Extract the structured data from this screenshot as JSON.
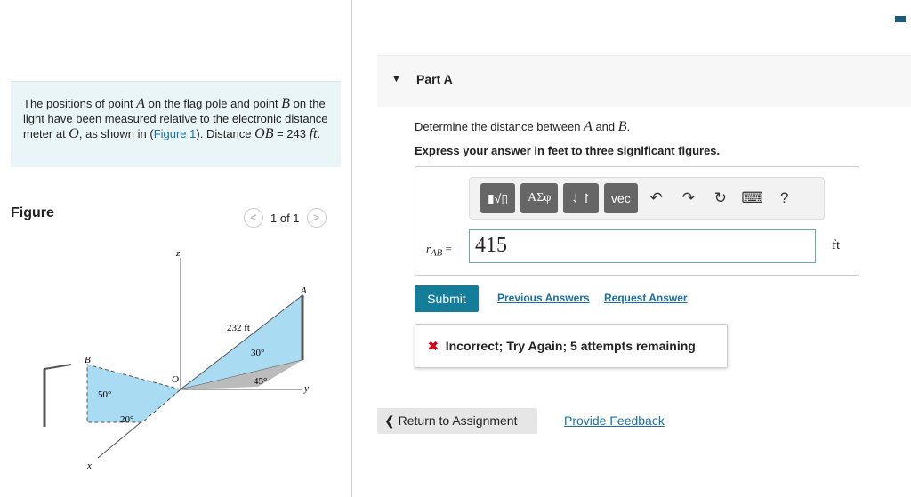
{
  "problem": {
    "t1": "The positions of point ",
    "A": "A",
    "t2": " on the flag pole and point ",
    "B": "B",
    "t3": " on the light have been measured relative to the electronic distance meter at ",
    "O": "O",
    "t4": ", as shown in (",
    "link": "Figure 1",
    "t5": "). Distance ",
    "OB": "OB",
    "t6": " = 243 ",
    "ft": "ft",
    "t7": "."
  },
  "figure": {
    "title": "Figure",
    "pager": "1 of 1",
    "labels": {
      "z": "z",
      "A": "A",
      "B": "B",
      "O": "O",
      "x": "x",
      "y": "y",
      "d232": "232 ft",
      "a30": "30°",
      "a45": "45°",
      "a50": "50°",
      "a20": "20°"
    }
  },
  "part": {
    "label": "Part A",
    "q_pre": "Determine the distance between ",
    "qA": "A",
    "q_and": " and ",
    "qB": "B",
    "q_end": ".",
    "instr": "Express your answer in feet to three significant figures."
  },
  "toolbar": {
    "greek": "ΑΣφ",
    "arrows": "⇃↾",
    "vec": "vec",
    "help": "?"
  },
  "answer": {
    "var": "r",
    "sub": "AB",
    "eq": " =",
    "value": "415",
    "unit": "ft"
  },
  "actions": {
    "submit": "Submit",
    "previous": "Previous Answers",
    "request": "Request Answer"
  },
  "feedback": {
    "text": "Incorrect; Try Again; 5 attempts remaining"
  },
  "footer": {
    "return": "Return to Assignment",
    "feedback": "Provide Feedback"
  }
}
